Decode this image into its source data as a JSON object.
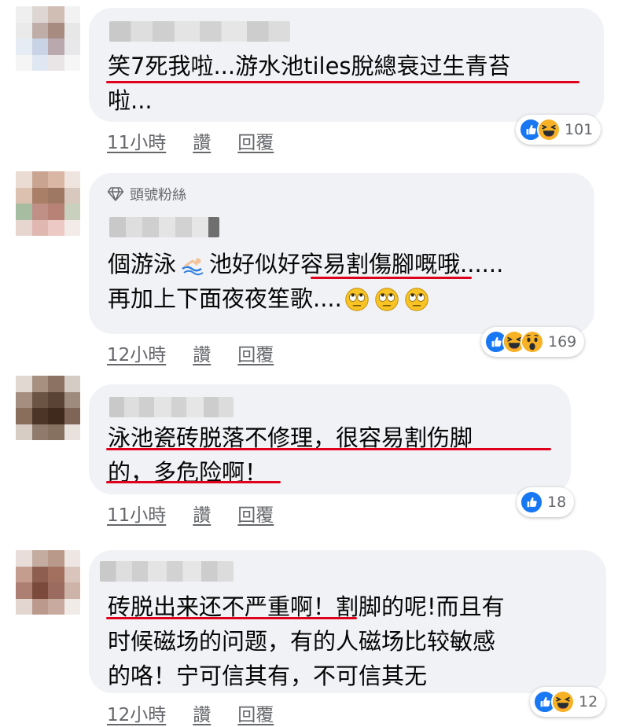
{
  "comments": [
    {
      "text": "笑7死我啦...游水池tiles脫總衰过生青苔\n啦...",
      "time": "11小時",
      "like_label": "讚",
      "reply_label": "回覆",
      "reactions": [
        "like",
        "haha"
      ],
      "reaction_count": "101"
    },
    {
      "badge": "頭號粉絲",
      "text_line1_before": "個游泳",
      "text_line1_after": "池好似好容易割傷腳嘅哦......",
      "text_line2": "再加上下面夜夜笙歌....",
      "time": "12小時",
      "like_label": "讚",
      "reply_label": "回覆",
      "reactions": [
        "like",
        "haha",
        "wow"
      ],
      "reaction_count": "169"
    },
    {
      "text": "泳池瓷砖脱落不修理，很容易割伤脚\n的，多危险啊！",
      "time": "11小時",
      "like_label": "讚",
      "reply_label": "回覆",
      "reactions": [
        "like"
      ],
      "reaction_count": "18"
    },
    {
      "text": "砖脱出来还不严重啊！割脚的呢!而且有\n时候磁场的问题，有的人磁场比较敏感\n的咯！宁可信其有，不可信其无",
      "time": "12小時",
      "like_label": "讚",
      "reply_label": "回覆",
      "reactions": [
        "like",
        "haha"
      ],
      "reaction_count": "12"
    }
  ],
  "colors": {
    "bubble": "#f0f2f5",
    "underline": "#e0001b",
    "like_blue": "#1877f2",
    "meta_gray": "#65676b"
  }
}
